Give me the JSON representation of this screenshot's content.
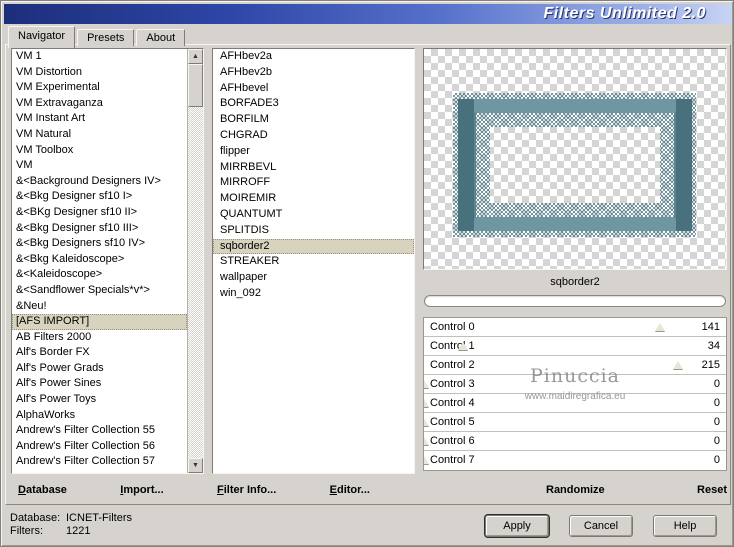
{
  "window": {
    "title": "Filters Unlimited 2.0"
  },
  "tabs": [
    {
      "label": "Navigator",
      "active": true
    },
    {
      "label": "Presets",
      "active": false
    },
    {
      "label": "About",
      "active": false
    }
  ],
  "categories": {
    "selected": "[AFS IMPORT]",
    "items": [
      "VM 1",
      "VM Distortion",
      "VM Experimental",
      "VM Extravaganza",
      "VM Instant Art",
      "VM Natural",
      "VM Toolbox",
      "VM",
      "&<Background Designers IV>",
      "&<Bkg Designer sf10 I>",
      "&<BKg Designer sf10 II>",
      "&<Bkg Designer sf10 III>",
      "&<Bkg Designers sf10 IV>",
      "&<Bkg Kaleidoscope>",
      "&<Kaleidoscope>",
      "&<Sandflower Specials*v*>",
      "&Neu!",
      "[AFS IMPORT]",
      "AB Filters 2000",
      "Alf's Border FX",
      "Alf's Power Grads",
      "Alf's Power Sines",
      "Alf's Power Toys",
      "AlphaWorks",
      "Andrew's Filter Collection 55",
      "Andrew's Filter Collection 56",
      "Andrew's Filter Collection 57"
    ]
  },
  "filters": {
    "selected": "sqborder2",
    "items": [
      "AFHbev2a",
      "AFHbev2b",
      "AFHbevel",
      "BORFADE3",
      "BORFILM",
      "CHGRAD",
      "flipper",
      "MIRRBEVL",
      "MIRROFF",
      "MOIREMIR",
      "QUANTUMT",
      "SPLITDIS",
      "sqborder2",
      "STREAKER",
      "wallpaper",
      "win_092"
    ]
  },
  "preview": {
    "label": "sqborder2",
    "effect_color": "#5b8591"
  },
  "controls": [
    {
      "label": "Control 0",
      "value": "141",
      "marker_pct": 78
    },
    {
      "label": "Control 1",
      "value": "34",
      "marker_pct": 13
    },
    {
      "label": "Control 2",
      "value": "215",
      "marker_pct": 84
    },
    {
      "label": "Control 3",
      "value": "0",
      "marker_pct": 0
    },
    {
      "label": "Control 4",
      "value": "0",
      "marker_pct": 0
    },
    {
      "label": "Control 5",
      "value": "0",
      "marker_pct": 0
    },
    {
      "label": "Control 6",
      "value": "0",
      "marker_pct": 0
    },
    {
      "label": "Control 7",
      "value": "0",
      "marker_pct": 0
    }
  ],
  "watermark": {
    "line1": "Pinuccia",
    "line2": "www.maidiregrafica.eu"
  },
  "commands": {
    "left": [
      {
        "name": "database-button",
        "label": "Database",
        "underline": 0
      },
      {
        "name": "import-button",
        "label": "Import...",
        "underline": 0
      },
      {
        "name": "filter-info-button",
        "label": "Filter Info...",
        "underline": 0
      },
      {
        "name": "editor-button",
        "label": "Editor...",
        "underline": 0
      }
    ],
    "right": [
      {
        "name": "randomize-button",
        "label": "Randomize",
        "underline": -1
      },
      {
        "name": "reset-button",
        "label": "Reset",
        "underline": -1
      }
    ]
  },
  "status": {
    "database_label": "Database:",
    "database_value": "ICNET-Filters",
    "filters_label": "Filters:",
    "filters_value": "1221"
  },
  "buttons": {
    "apply": "Apply",
    "cancel": "Cancel",
    "help": "Help"
  },
  "icons": {
    "scroll_up": "▲",
    "scroll_down": "▼"
  }
}
